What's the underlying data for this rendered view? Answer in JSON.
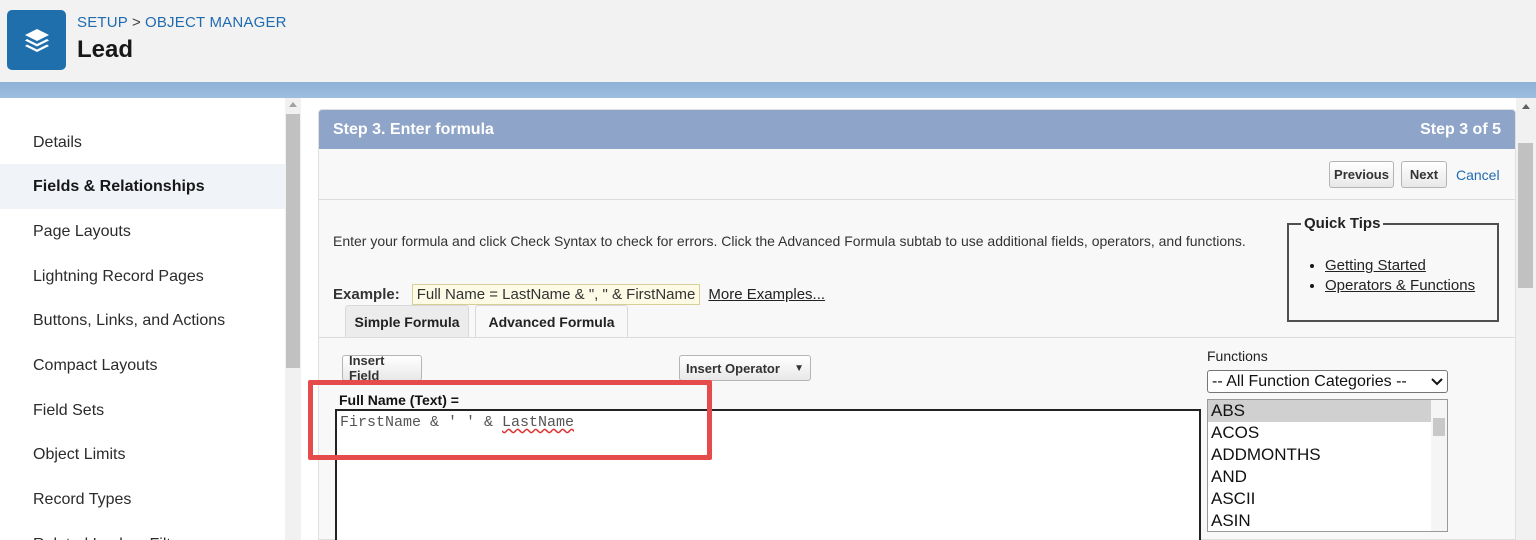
{
  "header": {
    "breadcrumb": [
      "SETUP",
      "OBJECT MANAGER"
    ],
    "breadcrumb_separator": ">",
    "title": "Lead",
    "icon": "layers-icon",
    "icon_color": "#1e6fab"
  },
  "sidebar": {
    "items": [
      {
        "label": "Details",
        "active": false
      },
      {
        "label": "Fields & Relationships",
        "active": true
      },
      {
        "label": "Page Layouts",
        "active": false
      },
      {
        "label": "Lightning Record Pages",
        "active": false
      },
      {
        "label": "Buttons, Links, and Actions",
        "active": false
      },
      {
        "label": "Compact Layouts",
        "active": false
      },
      {
        "label": "Field Sets",
        "active": false
      },
      {
        "label": "Object Limits",
        "active": false
      },
      {
        "label": "Record Types",
        "active": false
      },
      {
        "label": "Related Lookup Filters",
        "active": false
      }
    ]
  },
  "step": {
    "title": "Step 3. Enter formula",
    "count": "Step 3 of 5",
    "bar_color": "#8ea4c8"
  },
  "actions": {
    "previous": "Previous",
    "next": "Next",
    "cancel": "Cancel"
  },
  "intro_text": "Enter your formula and click Check Syntax to check for errors. Click the Advanced Formula subtab to use additional fields, operators, and functions.",
  "example": {
    "label": "Example:",
    "value": "Full Name = LastName & \", \" & FirstName",
    "more_link": "More Examples..."
  },
  "quick_tips": {
    "title": "Quick Tips",
    "links": [
      "Getting Started",
      "Operators & Functions"
    ]
  },
  "tabs": [
    "Simple Formula",
    "Advanced Formula"
  ],
  "active_tab": "Advanced Formula",
  "editor": {
    "insert_field": "Insert Field",
    "insert_operator": "Insert Operator",
    "field_label": "Full Name (Text) =",
    "formula_prefix": "FirstName & ' ' & ",
    "formula_misspelled": "LastName",
    "highlight_color": "#e54b4b"
  },
  "functions": {
    "label": "Functions",
    "category_selected": "-- All Function Categories --",
    "items": [
      "ABS",
      "ACOS",
      "ADDMONTHS",
      "AND",
      "ASCII",
      "ASIN"
    ],
    "selected": "ABS"
  }
}
